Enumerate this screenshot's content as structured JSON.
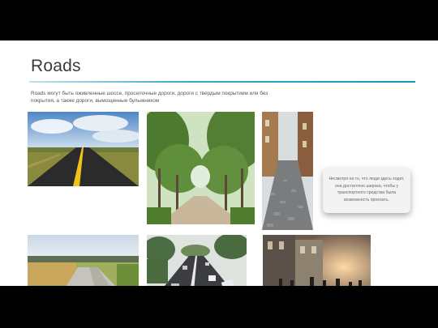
{
  "slide": {
    "title": "Roads",
    "description": "Roads могут быть оживленные шоссе, проселочные дороги, дороги с твердым покрытием или без покрытия, а также дороги, вымощенные булыжником",
    "accent_color": "#1f8fb8",
    "callout": {
      "text": "Несмотря на то, что люди здесь ходят, она достаточно широка, чтобы у транспортного средства была возможность проехать."
    }
  },
  "photos": [
    {
      "name": "highway-photo"
    },
    {
      "name": "tree-lined-road-photo"
    },
    {
      "name": "cobblestone-street-photo"
    },
    {
      "name": "gravel-road-photo"
    },
    {
      "name": "busy-highway-photo"
    },
    {
      "name": "pedestrian-street-photo"
    }
  ]
}
